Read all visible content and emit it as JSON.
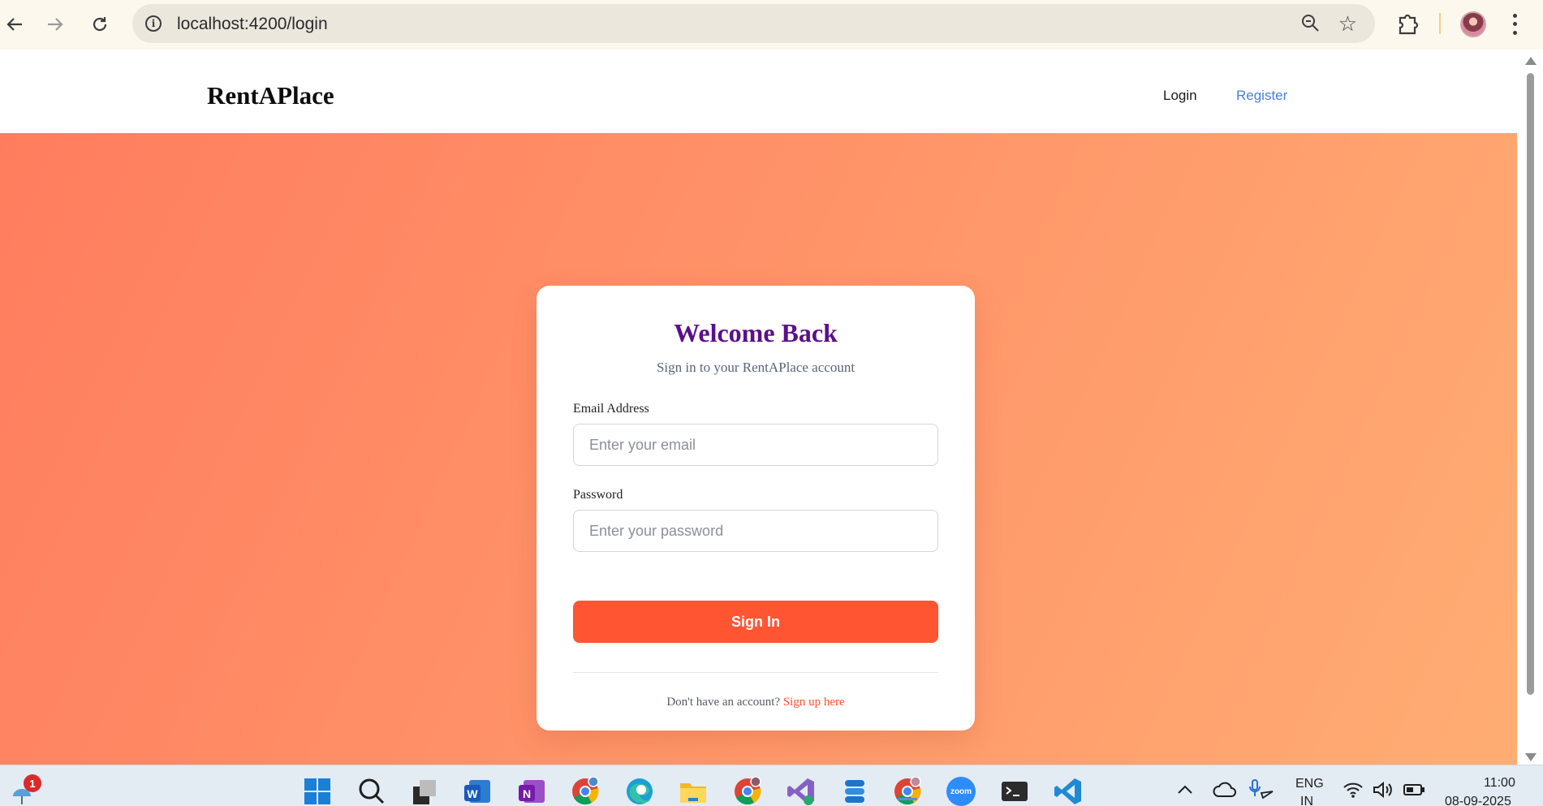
{
  "browser": {
    "url": "localhost:4200/login",
    "icons": {
      "back": "arrow-left-icon",
      "forward": "arrow-right-icon",
      "reload": "reload-icon",
      "site_info": "info-icon",
      "zoom": "zoom-icon",
      "bookmark": "star-icon",
      "extensions": "puzzle-icon",
      "profile": "profile-avatar",
      "menu": "kebab-menu-icon"
    }
  },
  "navbar": {
    "brand": "RentAPlace",
    "login_label": "Login",
    "register_label": "Register"
  },
  "login_card": {
    "title": "Welcome Back",
    "subtitle": "Sign in to your RentAPlace account",
    "email_label": "Email Address",
    "email_placeholder": "Enter your email",
    "email_value": "",
    "password_label": "Password",
    "password_placeholder": "Enter your password",
    "password_value": "",
    "submit_label": "Sign In",
    "signup_prompt": "Don't have an account?",
    "signup_link": "Sign up here"
  },
  "taskbar": {
    "notification_count": "1",
    "apps": [
      "start",
      "search",
      "task-view",
      "word",
      "onenote",
      "chrome-profile",
      "edge",
      "file-explorer",
      "chrome-profile-2",
      "visual-studio",
      "azure-data-studio",
      "chrome-active",
      "zoom",
      "terminal",
      "vscode"
    ],
    "zoom_label": "zoom",
    "language_line1": "ENG",
    "language_line2": "IN",
    "time": "11:00",
    "date": "08-09-2025"
  },
  "colors": {
    "accent": "#ff5533",
    "title": "#5b0f8c",
    "link": "#4a7fd9",
    "gradient_start": "#ff7d5e",
    "gradient_end": "#ffad73"
  }
}
